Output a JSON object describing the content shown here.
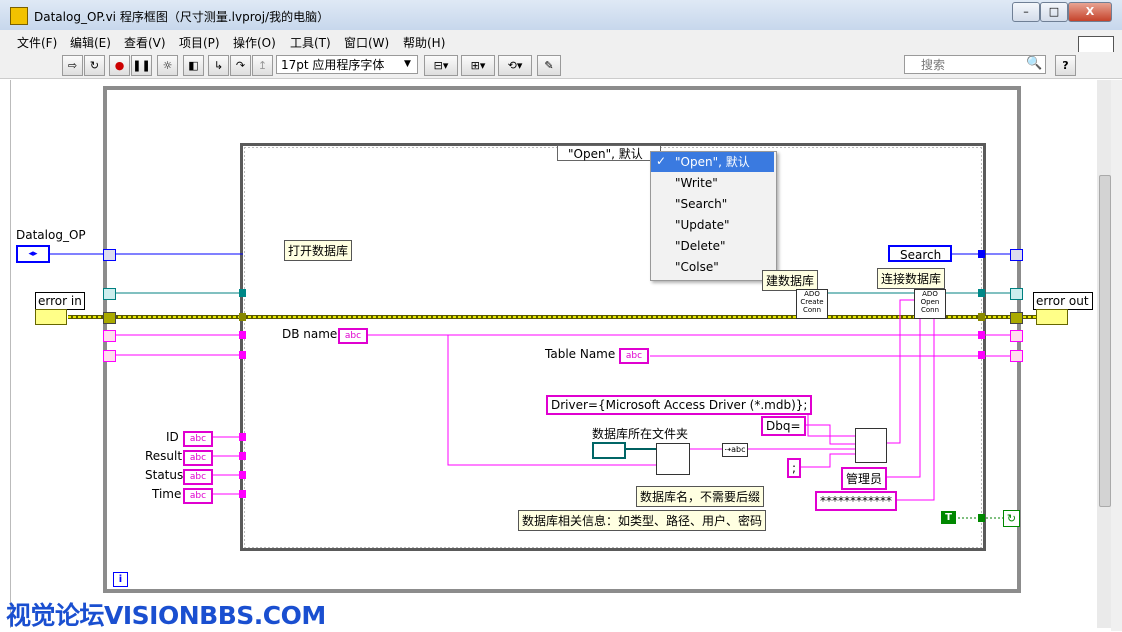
{
  "window": {
    "title": "Datalog_OP.vi 程序框图（尺寸测量.lvproj/我的电脑）",
    "min": "–",
    "max": "□",
    "close": "X"
  },
  "menu": [
    "文件(F)",
    "编辑(E)",
    "查看(V)",
    "项目(P)",
    "操作(O)",
    "工具(T)",
    "窗口(W)",
    "帮助(H)"
  ],
  "toolbar": {
    "font": "17pt 应用程序字体",
    "search_placeholder": "搜索",
    "help": "?"
  },
  "case_selector": {
    "value": "\"Open\", 默认",
    "options": [
      "\"Open\", 默认",
      "\"Write\"",
      "\"Search\"",
      "\"Update\"",
      "\"Delete\"",
      "\"Colse\""
    ],
    "selected_index": 0
  },
  "controls": {
    "datalog_op": "Datalog_OP",
    "error_in": "error in",
    "error_out": "error out",
    "search_enum": "Search"
  },
  "notes": {
    "open_db": "打开数据库",
    "create_db": "建数据库",
    "connect_db": "连接数据库",
    "db_name_note": "数据库名，不需要后缀",
    "db_info_note": "数据库相关信息：如类型、路径、用户、密码",
    "folder_label": "数据库所在文件夹"
  },
  "labels": {
    "db_name": "DB name",
    "table_name": "Table Name",
    "id": "ID",
    "result": "Result",
    "status": "Status",
    "time": "Time"
  },
  "strings": {
    "driver": "Driver={Microsoft Access Driver (*.mdb)};",
    "dbq": "Dbq=",
    "semicolon": ";",
    "admin": "管理员",
    "password": "************"
  },
  "ado": {
    "create": "ADO Create Conn",
    "open": "ADO Open Conn"
  },
  "const": {
    "true": "T",
    "info": "i",
    "abc": "abc"
  },
  "watermark": "视觉论坛VISIONBBS.COM"
}
